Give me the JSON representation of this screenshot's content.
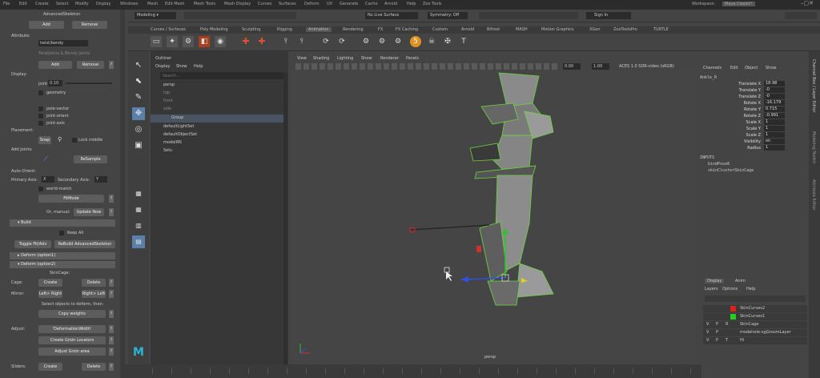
{
  "menubar": {
    "items": [
      "File",
      "Edit",
      "Create",
      "Select",
      "Modify",
      "Display",
      "Windows",
      "Mesh",
      "Edit Mesh",
      "Mesh Tools",
      "Mesh Display",
      "Curves",
      "Surfaces",
      "Deform",
      "UV",
      "Generate",
      "Cache",
      "Arnold",
      "Help",
      "Zoo Tools"
    ],
    "workspace_label": "Workspace:",
    "workspace_value": "Maya Classic*"
  },
  "statusline": {
    "mode": "Modeling",
    "live_surface": "No Live Surface",
    "symmetry": "Symmetry: Off",
    "signin": "Sign In"
  },
  "shelf_tabs": [
    "Curves / Surfaces",
    "Poly Modeling",
    "Sculpting",
    "Rigging",
    "Animation",
    "Rendering",
    "FX",
    "FX Caching",
    "Custom",
    "Arnold",
    "Bifrost",
    "MASH",
    "Motion Graphics",
    "XGen",
    "ZooToolsPro",
    "TURTLE"
  ],
  "left_panel": {
    "title": "AdvancedSkeleton",
    "add": "Add",
    "remove": "Remove",
    "attribute_label": "Attribute:",
    "attribute_value": "twist/bendy",
    "twist_hint": "TwistJoints & Bendy Joints",
    "display_label": "Display:",
    "joint_label": "joint",
    "joint_value": "0.10",
    "geometry": "geometry",
    "pole_vector": "pole-vector",
    "joint_orient": "joint-orient",
    "joint_axis": "joint-axis",
    "placement_label": "Placement:",
    "snap": "Snap",
    "lock_middle": "Lock middle",
    "add_joints_label": "Add Joints:",
    "resample": "ReSample",
    "auto_orient_label": "Auto-Orient:",
    "primary_axis_label": "Primary Axis:",
    "primary_axis": "X",
    "secondary_axis_label": "Secondary Axis:",
    "secondary_axis": "Y",
    "world_match": "world-match",
    "fitmode": "FitMode",
    "or_manual": "Or, manual:",
    "update_now": "Update Now",
    "build": "Build",
    "keep_all": "Keep All",
    "toggle_fit": "Toggle Fit/Adv",
    "rebuild": "ReBuild AdvancedSkeleton",
    "deform1": "Deform      (option1)",
    "deform2": "Deform      (option2)",
    "skincage": "SkinCage:",
    "cage_label": "Cage:",
    "create": "Create",
    "delete": "Delete",
    "mirror_label": "Mirror:",
    "left_right": "Left> Right",
    "right_left": "Right> Left",
    "select_hint": "Select objects to deform, then:",
    "copy_weights": "Copy weights",
    "adjust_label": "Adjust:",
    "deform_width": "'DeformationWidth'",
    "groin_locators": "Create Groin Locators",
    "adjust_groin": "Adjust Groin area",
    "sliders_label": "Sliders:",
    "create2": "Create",
    "delete2": "Delete",
    "qm": "?"
  },
  "outliner": {
    "title": "Outliner",
    "menus": [
      "Display",
      "Show",
      "Help"
    ],
    "search_placeholder": "Search...",
    "items": [
      "persp",
      "top",
      "front",
      "side",
      "Group",
      "defaultLightSet",
      "defaultObjectSet",
      "modelRN",
      "Sets"
    ]
  },
  "viewport": {
    "menus": [
      "View",
      "Shading",
      "Lighting",
      "Show",
      "Renderer",
      "Panels"
    ],
    "gamma_a": "0.00",
    "gamma_b": "1.00",
    "colorspace": "ACES 1.0 SDR-video (sRGB)",
    "camera": "persp"
  },
  "channel_box": {
    "menus": [
      "Channels",
      "Edit",
      "Object",
      "Show"
    ],
    "object": "Ankle_R",
    "attrs": [
      {
        "name": "Translate X",
        "value": "18.98"
      },
      {
        "name": "Translate Y",
        "value": "-0"
      },
      {
        "name": "Translate Z",
        "value": "-0"
      },
      {
        "name": "Rotate X",
        "value": "-16.179"
      },
      {
        "name": "Rotate Y",
        "value": "0.715"
      },
      {
        "name": "Rotate Z",
        "value": "-0.991"
      },
      {
        "name": "Scale X",
        "value": "1"
      },
      {
        "name": "Scale Y",
        "value": "1"
      },
      {
        "name": "Scale Z",
        "value": "1"
      },
      {
        "name": "Visibility",
        "value": "on"
      },
      {
        "name": "Radius",
        "value": "1"
      }
    ],
    "inputs_label": "INPUTS",
    "inputs": [
      "bindPose6",
      "skinClusterSkinCage"
    ]
  },
  "layers": {
    "tabs": [
      "Display",
      "Anim"
    ],
    "menus": [
      "Layers",
      "Options",
      "Help"
    ],
    "rows": [
      {
        "v": "",
        "p": "",
        "r": "",
        "name": "SkinCurves2",
        "color": "#e02020"
      },
      {
        "v": "",
        "p": "",
        "r": "",
        "name": "SkinCurves1",
        "color": "#20d020"
      },
      {
        "v": "V",
        "p": "P",
        "r": "R",
        "name": "SkinCage",
        "color": ""
      },
      {
        "v": "V",
        "p": "P",
        "r": "",
        "name": "modelrole:xgGroomLayer",
        "color": ""
      },
      {
        "v": "V",
        "p": "P",
        "r": "T",
        "name": "Hi",
        "color": ""
      }
    ]
  },
  "side_tabs": [
    "Channel Box / Layer Editor",
    "Modeling Toolkit",
    "Attribute Editor"
  ]
}
